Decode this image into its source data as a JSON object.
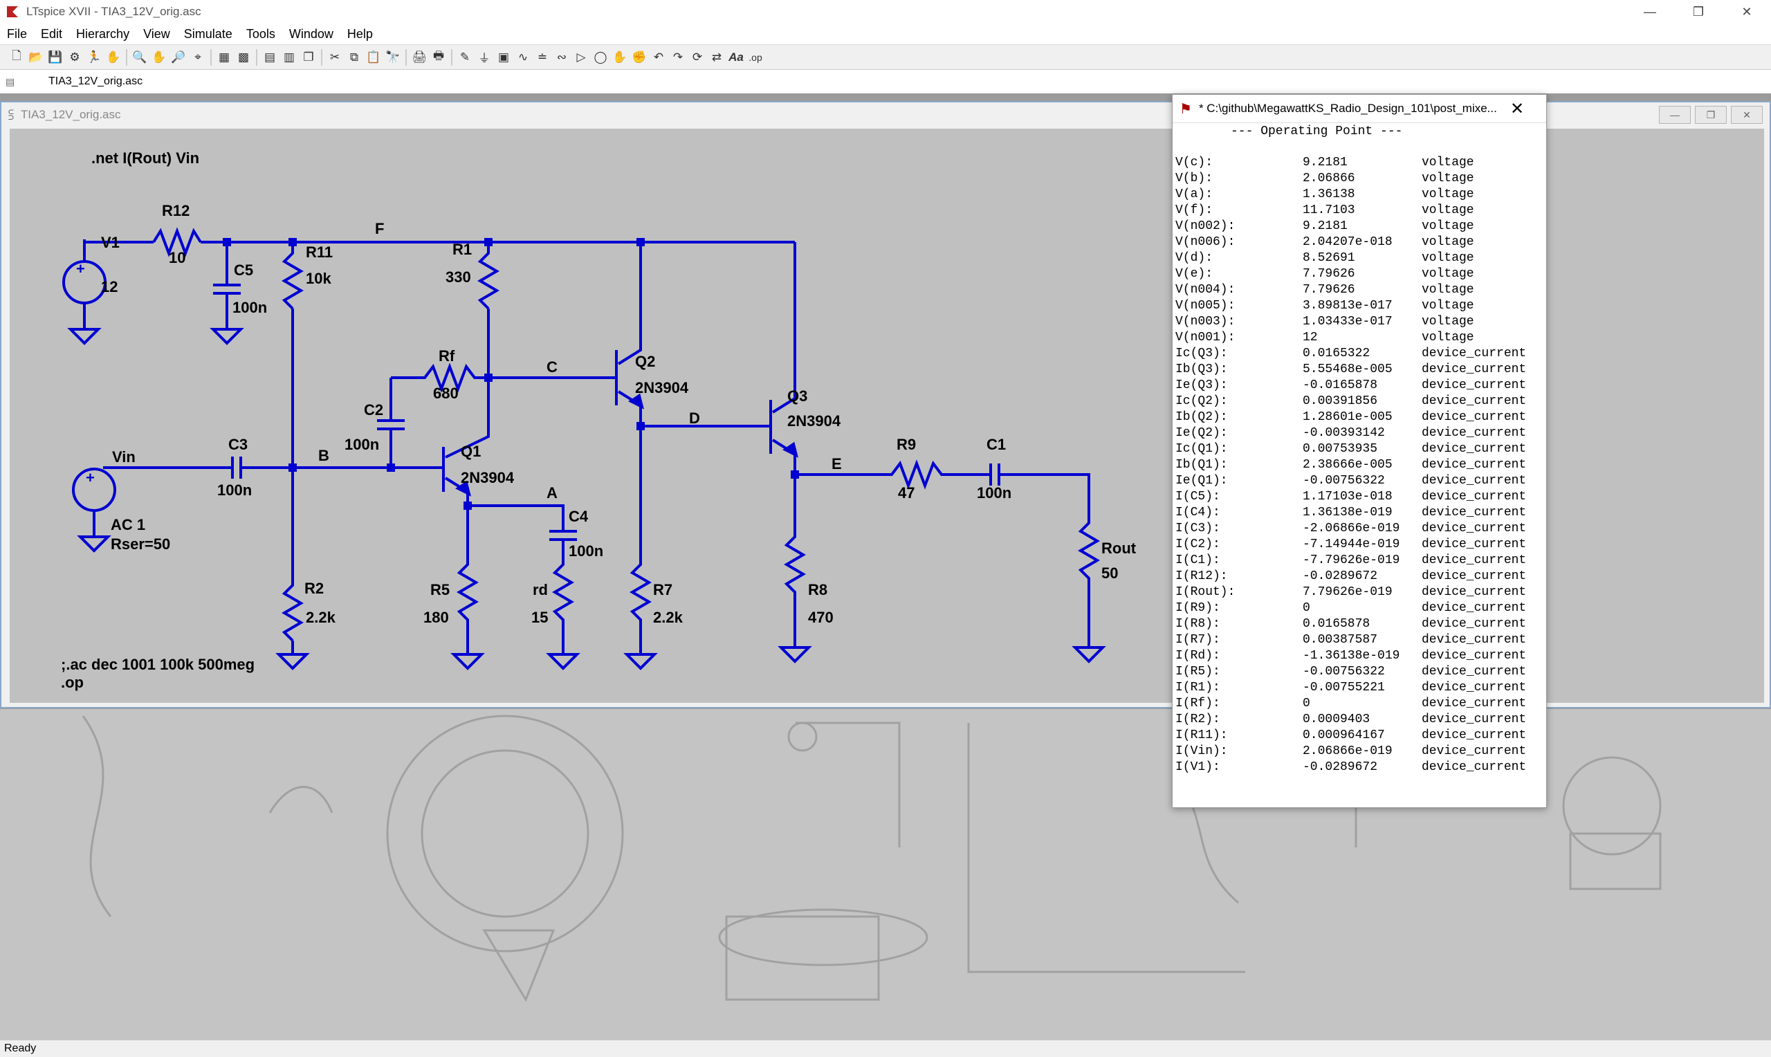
{
  "window": {
    "title": "LTspice XVII - TIA3_12V_orig.asc"
  },
  "menu": [
    "File",
    "Edit",
    "Hierarchy",
    "View",
    "Simulate",
    "Tools",
    "Window",
    "Help"
  ],
  "tab": {
    "label": "TIA3_12V_orig.asc"
  },
  "schematic_window": {
    "title": "TIA3_12V_orig.asc"
  },
  "schematic": {
    "net_directive": ".net I(Rout) Vin",
    "ac_directive": ";.ac dec 1001 100k 500meg",
    "op_directive": ".op",
    "labels": {
      "V1": "V1",
      "V1_val": "12",
      "R12": "R12",
      "R12_val": "10",
      "C5": "C5",
      "C5_val": "100n",
      "R11": "R11",
      "R11_val": "10k",
      "F": "F",
      "R1": "R1",
      "R1_val": "330",
      "Rf": "Rf",
      "Rf_val": "680",
      "C": "C",
      "Q2": "Q2",
      "Q2_val": "2N3904",
      "C2": "C2",
      "C2_val": "100n",
      "Vin": "Vin",
      "C3": "C3",
      "C3_val": "100n",
      "B": "B",
      "Q1": "Q1",
      "Q1_val": "2N3904",
      "AC": "AC 1",
      "Rser": "Rser=50",
      "A": "A",
      "C4": "C4",
      "C4_val": "100n",
      "D": "D",
      "Q3": "Q3",
      "Q3_val": "2N3904",
      "E": "E",
      "R9": "R9",
      "R9_val": "47",
      "C1": "C1",
      "C1_val": "100n",
      "Rout": "Rout",
      "Rout_val": "50",
      "R2": "R2",
      "R2_val": "2.2k",
      "R5": "R5",
      "R5_val": "180",
      "rd": "rd",
      "rd_val": "15",
      "R7": "R7",
      "R7_val": "2.2k",
      "R8": "R8",
      "R8_val": "470"
    }
  },
  "op_window": {
    "title": "* C:\\github\\MegawattKS_Radio_Design_101\\post_mixe...",
    "header": "--- Operating Point ---",
    "rows": [
      {
        "name": "V(c):",
        "value": "9.2181",
        "unit": "voltage"
      },
      {
        "name": "V(b):",
        "value": "2.06866",
        "unit": "voltage"
      },
      {
        "name": "V(a):",
        "value": "1.36138",
        "unit": "voltage"
      },
      {
        "name": "V(f):",
        "value": "11.7103",
        "unit": "voltage"
      },
      {
        "name": "V(n002):",
        "value": "9.2181",
        "unit": "voltage"
      },
      {
        "name": "V(n006):",
        "value": "2.04207e-018",
        "unit": "voltage"
      },
      {
        "name": "V(d):",
        "value": "8.52691",
        "unit": "voltage"
      },
      {
        "name": "V(e):",
        "value": "7.79626",
        "unit": "voltage"
      },
      {
        "name": "V(n004):",
        "value": "7.79626",
        "unit": "voltage"
      },
      {
        "name": "V(n005):",
        "value": "3.89813e-017",
        "unit": "voltage"
      },
      {
        "name": "V(n003):",
        "value": "1.03433e-017",
        "unit": "voltage"
      },
      {
        "name": "V(n001):",
        "value": "12",
        "unit": "voltage"
      },
      {
        "name": "Ic(Q3):",
        "value": "0.0165322",
        "unit": "device_current"
      },
      {
        "name": "Ib(Q3):",
        "value": "5.55468e-005",
        "unit": "device_current"
      },
      {
        "name": "Ie(Q3):",
        "value": "-0.0165878",
        "unit": "device_current"
      },
      {
        "name": "Ic(Q2):",
        "value": "0.00391856",
        "unit": "device_current"
      },
      {
        "name": "Ib(Q2):",
        "value": "1.28601e-005",
        "unit": "device_current"
      },
      {
        "name": "Ie(Q2):",
        "value": "-0.00393142",
        "unit": "device_current"
      },
      {
        "name": "Ic(Q1):",
        "value": "0.00753935",
        "unit": "device_current"
      },
      {
        "name": "Ib(Q1):",
        "value": "2.38666e-005",
        "unit": "device_current"
      },
      {
        "name": "Ie(Q1):",
        "value": "-0.00756322",
        "unit": "device_current"
      },
      {
        "name": "I(C5):",
        "value": "1.17103e-018",
        "unit": "device_current"
      },
      {
        "name": "I(C4):",
        "value": "1.36138e-019",
        "unit": "device_current"
      },
      {
        "name": "I(C3):",
        "value": "-2.06866e-019",
        "unit": "device_current"
      },
      {
        "name": "I(C2):",
        "value": "-7.14944e-019",
        "unit": "device_current"
      },
      {
        "name": "I(C1):",
        "value": "-7.79626e-019",
        "unit": "device_current"
      },
      {
        "name": "I(R12):",
        "value": "-0.0289672",
        "unit": "device_current"
      },
      {
        "name": "I(Rout):",
        "value": "7.79626e-019",
        "unit": "device_current"
      },
      {
        "name": "I(R9):",
        "value": "0",
        "unit": "device_current"
      },
      {
        "name": "I(R8):",
        "value": "0.0165878",
        "unit": "device_current"
      },
      {
        "name": "I(R7):",
        "value": "0.00387587",
        "unit": "device_current"
      },
      {
        "name": "I(Rd):",
        "value": "-1.36138e-019",
        "unit": "device_current"
      },
      {
        "name": "I(R5):",
        "value": "-0.00756322",
        "unit": "device_current"
      },
      {
        "name": "I(R1):",
        "value": "-0.00755221",
        "unit": "device_current"
      },
      {
        "name": "I(Rf):",
        "value": "0",
        "unit": "device_current"
      },
      {
        "name": "I(R2):",
        "value": "0.0009403",
        "unit": "device_current"
      },
      {
        "name": "I(R11):",
        "value": "0.000964167",
        "unit": "device_current"
      },
      {
        "name": "I(Vin):",
        "value": "2.06866e-019",
        "unit": "device_current"
      },
      {
        "name": "I(V1):",
        "value": "-0.0289672",
        "unit": "device_current"
      }
    ]
  },
  "status": {
    "text": "Ready"
  },
  "colors": {
    "wire": "#0000d0",
    "canvas": "#c0c0c0"
  }
}
